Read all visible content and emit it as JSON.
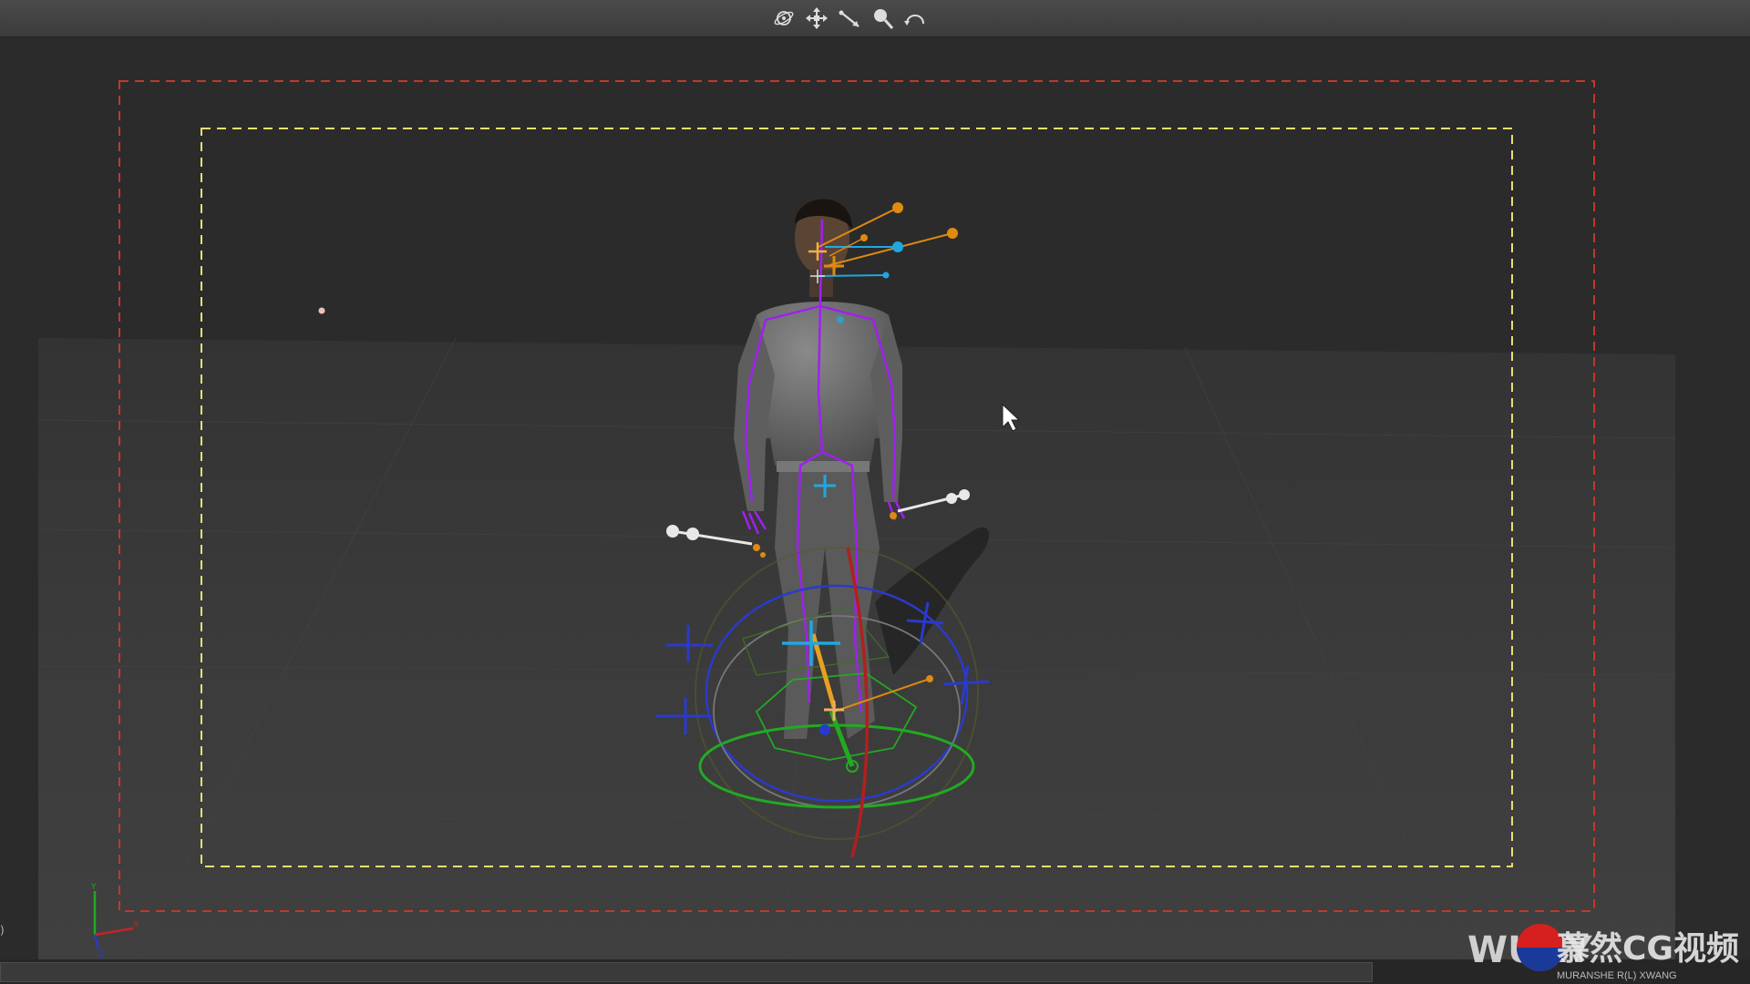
{
  "toolbar": {
    "tools": [
      {
        "icon": "orbit-icon"
      },
      {
        "icon": "pan-icon"
      },
      {
        "icon": "dolly-icon"
      },
      {
        "icon": "zoom-icon"
      },
      {
        "icon": "undo-view-icon"
      }
    ]
  },
  "viewport": {
    "axis_labels": {
      "y": "Y",
      "x": "X",
      "z": "Z"
    },
    "left_marker": ")"
  },
  "watermark": {
    "logo_text": "WUKY",
    "chinese_text": "慕然CG视频",
    "sub_text": "MURANSHE  R(L)  XWANG"
  },
  "colors": {
    "toolbar_bg": "#444444",
    "viewport_bg": "#2b2b2b",
    "floor": "#3a3a3a",
    "safe_frame_outer": "#c0392b",
    "safe_frame_inner": "#e6e070",
    "bone_purple": "#a020f0",
    "effector_orange": "#e08a10",
    "effector_cyan": "#1fa8e0",
    "ring_green": "#22aa22",
    "ring_blue": "#2a3acc"
  }
}
